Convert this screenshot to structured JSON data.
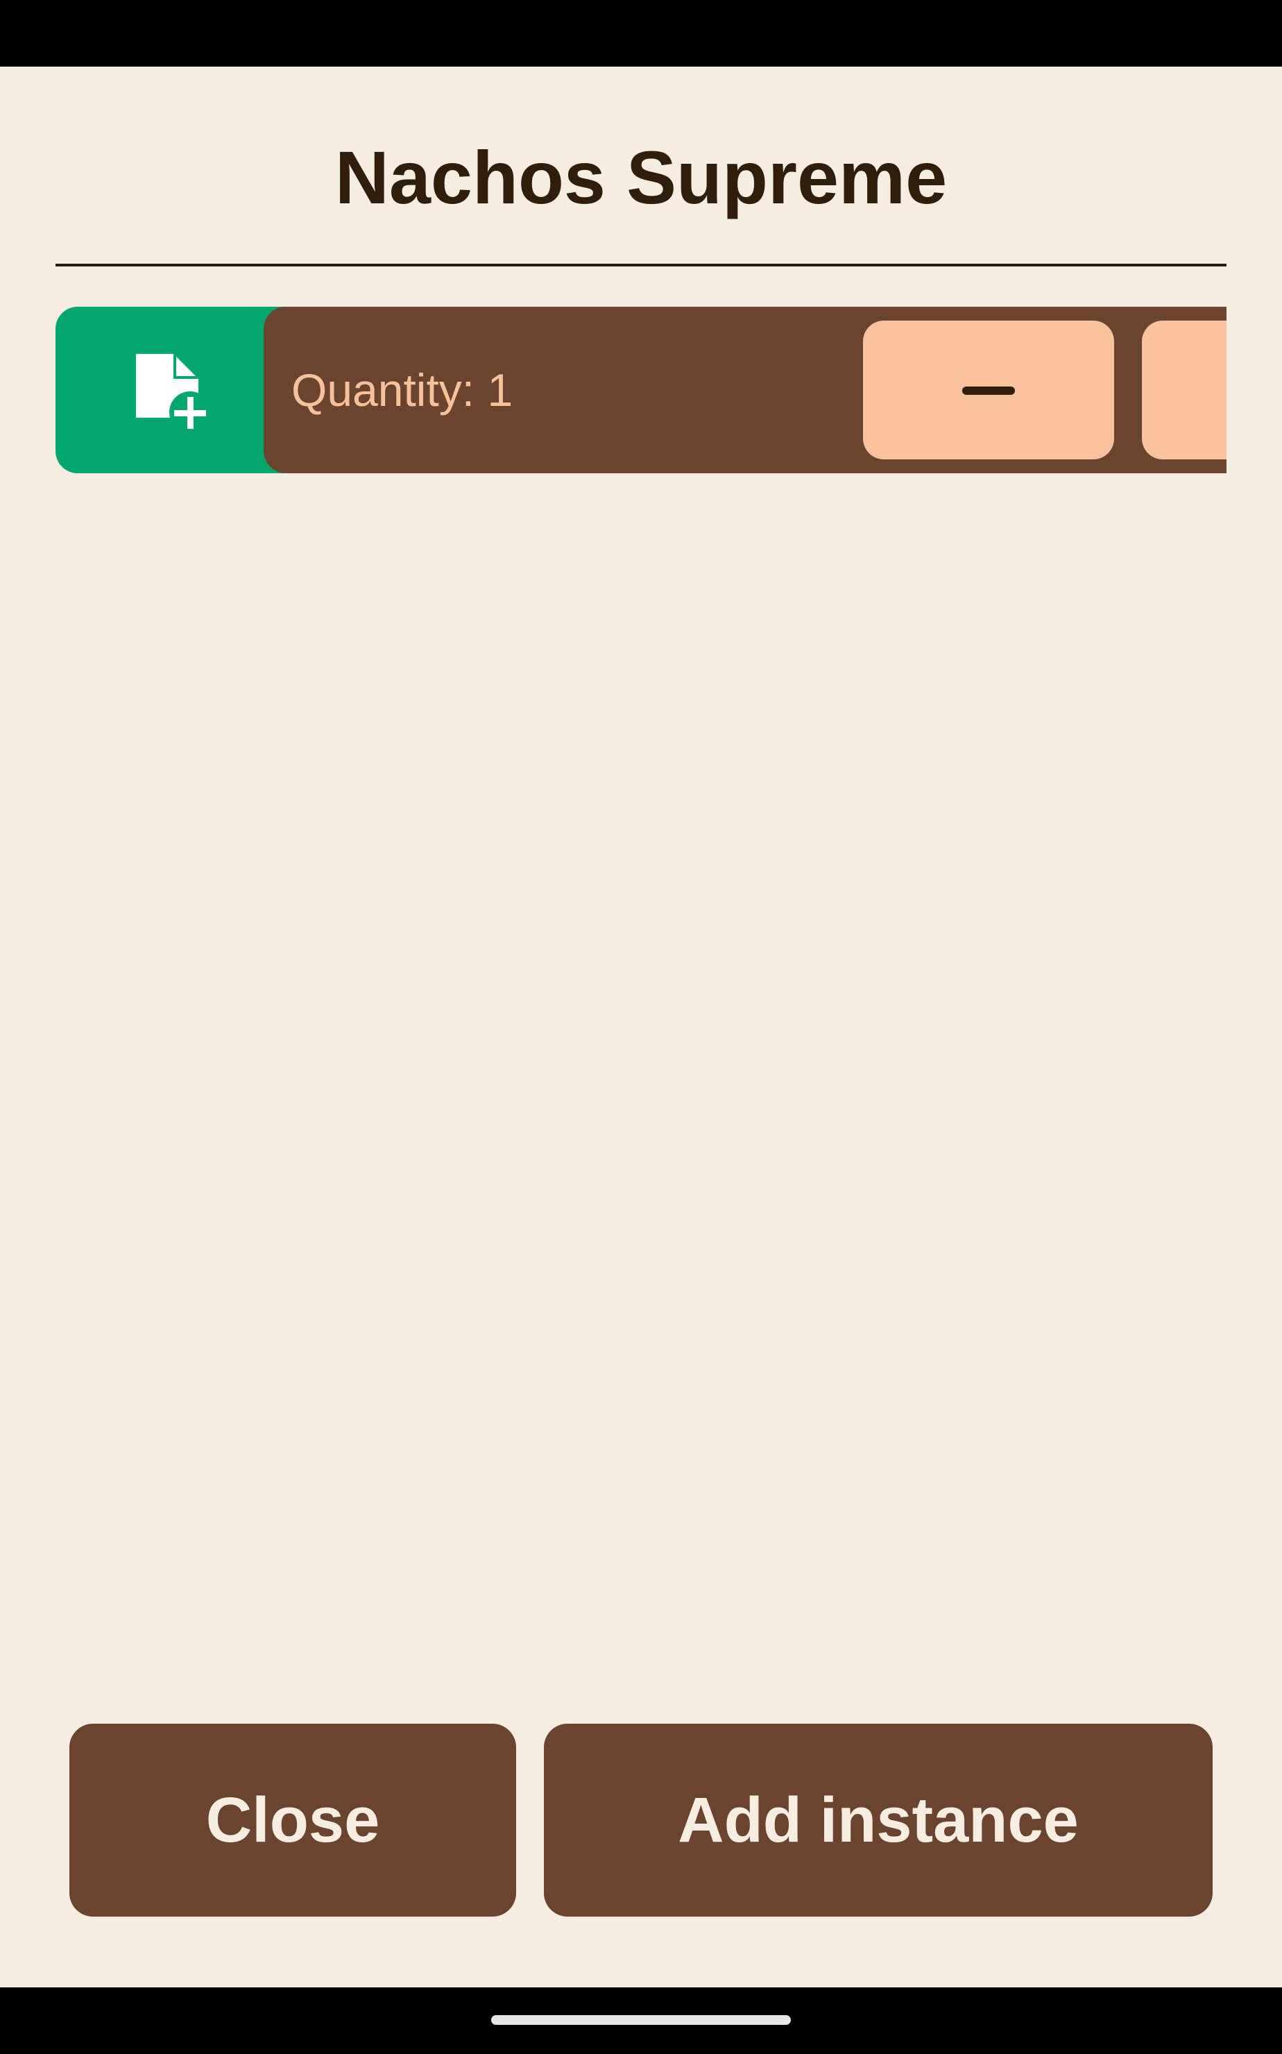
{
  "dialog": {
    "title": "Nachos Supreme"
  },
  "instance_row": {
    "quantity_label": "Quantity: 1",
    "swipe_action_icon": "note-add-icon",
    "decrement_icon": "minus-icon",
    "swipe_action_color": "#03a66f"
  },
  "actions": {
    "close_label": "Close",
    "add_instance_label": "Add instance"
  },
  "colors": {
    "background": "#f7ede3",
    "primary": "#6b4430",
    "accent": "#f9c19c",
    "title_text": "#2e1e0a"
  }
}
